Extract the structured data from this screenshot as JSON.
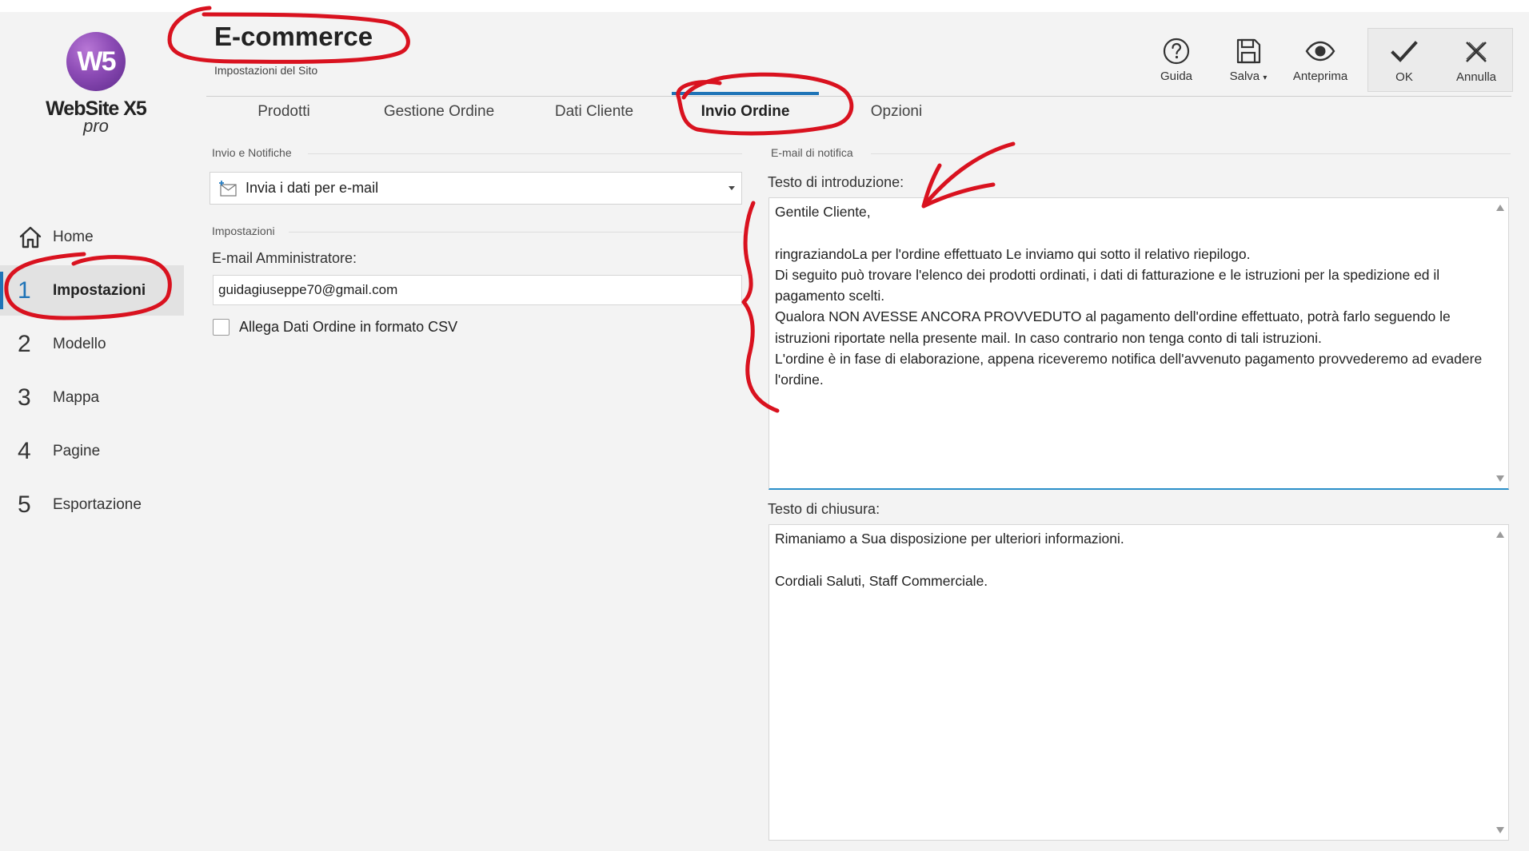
{
  "app": {
    "logo_initials": "W5",
    "logo_name": "WebSite X5",
    "logo_edition": "pro"
  },
  "header": {
    "title": "E-commerce",
    "subtitle": "Impostazioni del Sito"
  },
  "toolbar": {
    "guida": "Guida",
    "salva": "Salva",
    "anteprima": "Anteprima",
    "ok": "OK",
    "annulla": "Annulla"
  },
  "sidebar": {
    "items": [
      {
        "num": "",
        "label": "Home"
      },
      {
        "num": "1",
        "label": "Impostazioni"
      },
      {
        "num": "2",
        "label": "Modello"
      },
      {
        "num": "3",
        "label": "Mappa"
      },
      {
        "num": "4",
        "label": "Pagine"
      },
      {
        "num": "5",
        "label": "Esportazione"
      }
    ]
  },
  "tabs": [
    {
      "label": "Prodotti"
    },
    {
      "label": "Gestione Ordine"
    },
    {
      "label": "Dati Cliente"
    },
    {
      "label": "Invio Ordine"
    },
    {
      "label": "Opzioni"
    }
  ],
  "left_panel": {
    "group_invio": "Invio e Notifiche",
    "send_mode": "Invia i dati per e-mail",
    "group_impostazioni": "Impostazioni",
    "admin_email_label": "E-mail Amministratore:",
    "admin_email_value": "guidagiuseppe70@gmail.com",
    "attach_csv_label": "Allega Dati Ordine in formato CSV",
    "attach_csv_checked": false
  },
  "right_panel": {
    "group_label": "E-mail di notifica",
    "intro_label": "Testo di introduzione:",
    "intro_lines": [
      "Gentile Cliente,",
      "",
      "ringraziandoLa per l'ordine effettuato Le inviamo qui sotto il relativo riepilogo.",
      "Di seguito può trovare l'elenco dei prodotti ordinati, i dati di fatturazione e le istruzioni per la spedizione ed il pagamento scelti.",
      "Qualora NON AVESSE ANCORA PROVVEDUTO al pagamento dell'ordine effettuato, potrà farlo seguendo le istruzioni riportate nella presente mail. In caso contrario non tenga conto di tali istruzioni.",
      "L'ordine è in fase di elaborazione, appena riceveremo notifica dell'avvenuto pagamento provvederemo ad evadere l'ordine."
    ],
    "closing_label": "Testo di chiusura:",
    "closing_lines": [
      "Rimaniamo a Sua disposizione per ulteriori informazioni.",
      "",
      "Cordiali Saluti, Staff Commerciale."
    ]
  },
  "colors": {
    "accent": "#1f74b7",
    "annotation": "#d9121f",
    "background": "#f3f3f3"
  }
}
